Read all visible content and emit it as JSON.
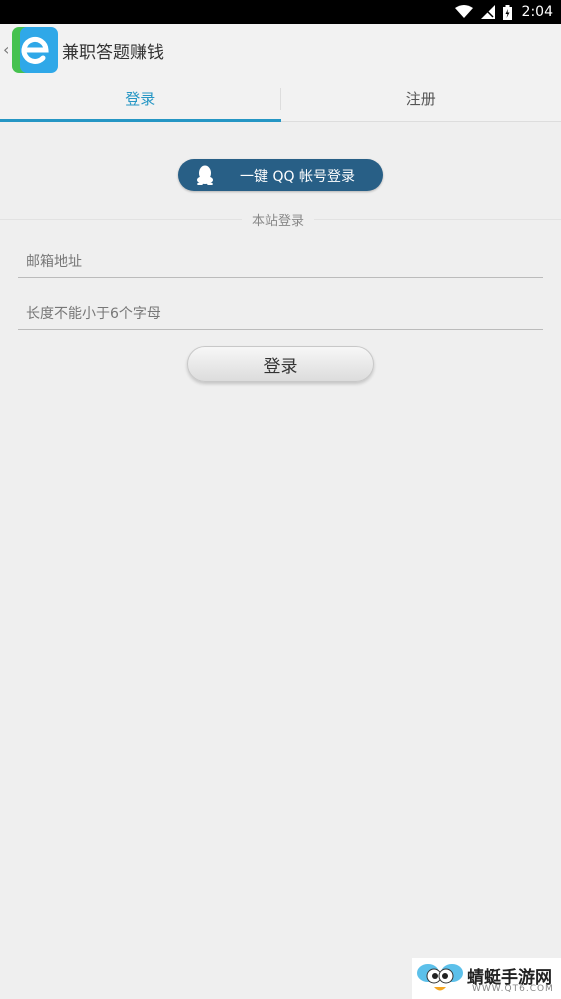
{
  "status_bar": {
    "time": "2:04",
    "icons": [
      "wifi-icon",
      "signal-icon",
      "battery-icon"
    ]
  },
  "app_bar": {
    "back_icon": "‹",
    "title": "兼职答题赚钱"
  },
  "tabs": [
    {
      "label": "登录",
      "active": true
    },
    {
      "label": "注册",
      "active": false
    }
  ],
  "qq_login": {
    "label": "一键 QQ 帐号登录"
  },
  "section_label": "本站登录",
  "email_field": {
    "value": "",
    "placeholder": "邮箱地址"
  },
  "password_field": {
    "value": "",
    "placeholder": "长度不能小于6个字母"
  },
  "login_button": {
    "label": "登录"
  },
  "watermark": {
    "title": "蜻蜓手游网",
    "url": "WWW.QT6.COM"
  },
  "colors": {
    "accent": "#2596c4",
    "qq_button": "#285f86",
    "background": "#efefef"
  }
}
